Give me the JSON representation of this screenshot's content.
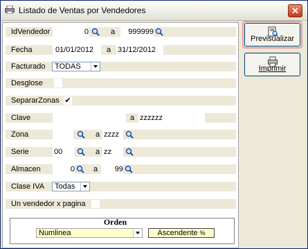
{
  "window": {
    "title": "Listado de Ventas por Vendedores",
    "close_label": "✕"
  },
  "form": {
    "id_vendedor": {
      "label": "IdVendedor",
      "from": "0",
      "a": "a",
      "to": "999999"
    },
    "fecha": {
      "label": "Fecha",
      "from": "01/01/2012",
      "a": "a",
      "to": "31/12/2012"
    },
    "facturado": {
      "label": "Facturado",
      "value": "TODAS"
    },
    "desglose": {
      "label": "Desglose",
      "checked": false
    },
    "separar_zonas": {
      "label": "SepararZonas",
      "checked": true,
      "mark": "✔"
    },
    "clave": {
      "label": "Clave",
      "from": "",
      "a": "a",
      "to": "zzzzzz"
    },
    "zona": {
      "label": "Zona",
      "from": "",
      "a": "a",
      "to": "zzzz"
    },
    "serie": {
      "label": "Serie",
      "from": "00",
      "a": "a",
      "to": "zz"
    },
    "almacen": {
      "label": "Almacen",
      "from": "0",
      "a": "a",
      "to": "99"
    },
    "clase_iva": {
      "label": "Clase IVA",
      "value": "Todas"
    },
    "un_vendedor": {
      "label": "Un vendedor x pagina",
      "checked": false
    }
  },
  "orden": {
    "title": "Orden",
    "value": "Numlinea",
    "sort_label": "Ascendente",
    "sort_suffix": "%"
  },
  "buttons": {
    "previsualizar": "Previsualizar",
    "imprimir": "Imprimir"
  },
  "colors": {
    "focus_outline": "#e79c9c",
    "title_border": "#0a246a",
    "orden_field": "#ffffcc"
  }
}
